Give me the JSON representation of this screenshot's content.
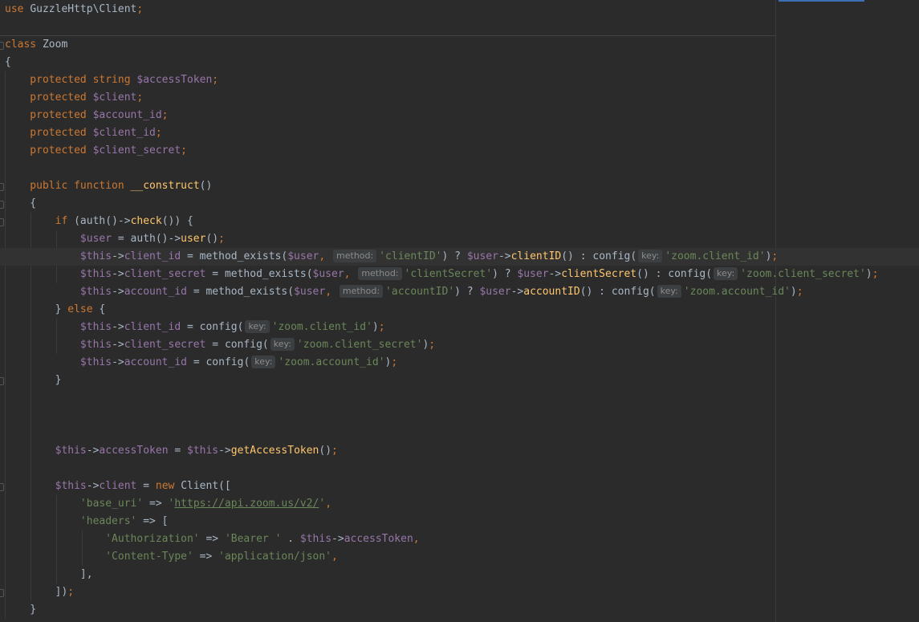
{
  "editor": {
    "lines": [
      {
        "segments": [
          {
            "t": "use ",
            "c": "kw"
          },
          {
            "t": "GuzzleHttp\\Client",
            "c": "cls"
          },
          {
            "t": ";",
            "c": "kw"
          }
        ]
      },
      {
        "segments": []
      },
      {
        "segments": [
          {
            "t": "class ",
            "c": "kw"
          },
          {
            "t": "Zoom",
            "c": "cls"
          }
        ]
      },
      {
        "segments": [
          {
            "t": "{",
            "c": "pl"
          }
        ]
      },
      {
        "segments": [
          {
            "t": "    protected string ",
            "c": "kw"
          },
          {
            "t": "$accessToken",
            "c": "var"
          },
          {
            "t": ";",
            "c": "kw"
          }
        ]
      },
      {
        "segments": [
          {
            "t": "    protected ",
            "c": "kw"
          },
          {
            "t": "$client",
            "c": "var"
          },
          {
            "t": ";",
            "c": "kw"
          }
        ]
      },
      {
        "segments": [
          {
            "t": "    protected ",
            "c": "kw"
          },
          {
            "t": "$account_id",
            "c": "var"
          },
          {
            "t": ";",
            "c": "kw"
          }
        ]
      },
      {
        "segments": [
          {
            "t": "    protected ",
            "c": "kw"
          },
          {
            "t": "$client_id",
            "c": "var"
          },
          {
            "t": ";",
            "c": "kw"
          }
        ]
      },
      {
        "segments": [
          {
            "t": "    protected ",
            "c": "kw"
          },
          {
            "t": "$client_secret",
            "c": "var"
          },
          {
            "t": ";",
            "c": "kw"
          }
        ]
      },
      {
        "segments": []
      },
      {
        "segments": [
          {
            "t": "    public function ",
            "c": "kw"
          },
          {
            "t": "__construct",
            "c": "fn"
          },
          {
            "t": "()",
            "c": "pl"
          }
        ]
      },
      {
        "segments": [
          {
            "t": "    {",
            "c": "pl"
          }
        ]
      },
      {
        "segments": [
          {
            "t": "        ",
            "c": "pl"
          },
          {
            "t": "if ",
            "c": "kw"
          },
          {
            "t": "(auth()->",
            "c": "pl"
          },
          {
            "t": "check",
            "c": "fn"
          },
          {
            "t": "()) {",
            "c": "pl"
          }
        ]
      },
      {
        "segments": [
          {
            "t": "            ",
            "c": "pl"
          },
          {
            "t": "$user",
            "c": "var"
          },
          {
            "t": " = auth()->",
            "c": "pl"
          },
          {
            "t": "user",
            "c": "fn"
          },
          {
            "t": "()",
            "c": "pl"
          },
          {
            "t": ";",
            "c": "kw"
          }
        ]
      },
      {
        "current": true,
        "segments": [
          {
            "t": "            ",
            "c": "pl"
          },
          {
            "t": "$this",
            "c": "var"
          },
          {
            "t": "->",
            "c": "pl"
          },
          {
            "t": "client_id",
            "c": "var"
          },
          {
            "t": " = method_exists(",
            "c": "pl"
          },
          {
            "t": "$user",
            "c": "var"
          },
          {
            "t": ", ",
            "c": "kw"
          },
          {
            "t": "method:",
            "c": "hint"
          },
          {
            "t": "'clientID'",
            "c": "str"
          },
          {
            "t": ") ? ",
            "c": "pl"
          },
          {
            "t": "$user",
            "c": "var"
          },
          {
            "t": "->",
            "c": "pl"
          },
          {
            "t": "clientID",
            "c": "fn"
          },
          {
            "t": "() : config(",
            "c": "pl"
          },
          {
            "t": "key:",
            "c": "hint"
          },
          {
            "t": "'zoom.client_id'",
            "c": "str"
          },
          {
            "t": ")",
            "c": "pl"
          },
          {
            "t": ";",
            "c": "kw"
          }
        ]
      },
      {
        "segments": [
          {
            "t": "            ",
            "c": "pl"
          },
          {
            "t": "$this",
            "c": "var"
          },
          {
            "t": "->",
            "c": "pl"
          },
          {
            "t": "client_secret",
            "c": "var"
          },
          {
            "t": " = method_exists(",
            "c": "pl"
          },
          {
            "t": "$user",
            "c": "var"
          },
          {
            "t": ", ",
            "c": "kw"
          },
          {
            "t": "method:",
            "c": "hint"
          },
          {
            "t": "'clientSecret'",
            "c": "str"
          },
          {
            "t": ") ? ",
            "c": "pl"
          },
          {
            "t": "$user",
            "c": "var"
          },
          {
            "t": "->",
            "c": "pl"
          },
          {
            "t": "clientSecret",
            "c": "fn"
          },
          {
            "t": "() : config(",
            "c": "pl"
          },
          {
            "t": "key:",
            "c": "hint"
          },
          {
            "t": "'zoom.client_secret'",
            "c": "str"
          },
          {
            "t": ")",
            "c": "pl"
          },
          {
            "t": ";",
            "c": "kw"
          }
        ]
      },
      {
        "segments": [
          {
            "t": "            ",
            "c": "pl"
          },
          {
            "t": "$this",
            "c": "var"
          },
          {
            "t": "->",
            "c": "pl"
          },
          {
            "t": "account_id",
            "c": "var"
          },
          {
            "t": " = method_exists(",
            "c": "pl"
          },
          {
            "t": "$user",
            "c": "var"
          },
          {
            "t": ", ",
            "c": "kw"
          },
          {
            "t": "method:",
            "c": "hint"
          },
          {
            "t": "'accountID'",
            "c": "str"
          },
          {
            "t": ") ? ",
            "c": "pl"
          },
          {
            "t": "$user",
            "c": "var"
          },
          {
            "t": "->",
            "c": "pl"
          },
          {
            "t": "accountID",
            "c": "fn"
          },
          {
            "t": "() : config(",
            "c": "pl"
          },
          {
            "t": "key:",
            "c": "hint"
          },
          {
            "t": "'zoom.account_id'",
            "c": "str"
          },
          {
            "t": ")",
            "c": "pl"
          },
          {
            "t": ";",
            "c": "kw"
          }
        ]
      },
      {
        "segments": [
          {
            "t": "        } ",
            "c": "pl"
          },
          {
            "t": "else ",
            "c": "kw"
          },
          {
            "t": "{",
            "c": "pl"
          }
        ]
      },
      {
        "segments": [
          {
            "t": "            ",
            "c": "pl"
          },
          {
            "t": "$this",
            "c": "var"
          },
          {
            "t": "->",
            "c": "pl"
          },
          {
            "t": "client_id",
            "c": "var"
          },
          {
            "t": " = config(",
            "c": "pl"
          },
          {
            "t": "key:",
            "c": "hint"
          },
          {
            "t": "'zoom.client_id'",
            "c": "str"
          },
          {
            "t": ")",
            "c": "pl"
          },
          {
            "t": ";",
            "c": "kw"
          }
        ]
      },
      {
        "segments": [
          {
            "t": "            ",
            "c": "pl"
          },
          {
            "t": "$this",
            "c": "var"
          },
          {
            "t": "->",
            "c": "pl"
          },
          {
            "t": "client_secret",
            "c": "var"
          },
          {
            "t": " = config(",
            "c": "pl"
          },
          {
            "t": "key:",
            "c": "hint"
          },
          {
            "t": "'zoom.client_secret'",
            "c": "str"
          },
          {
            "t": ")",
            "c": "pl"
          },
          {
            "t": ";",
            "c": "kw"
          }
        ]
      },
      {
        "segments": [
          {
            "t": "            ",
            "c": "pl"
          },
          {
            "t": "$this",
            "c": "var"
          },
          {
            "t": "->",
            "c": "pl"
          },
          {
            "t": "account_id",
            "c": "var"
          },
          {
            "t": " = config(",
            "c": "pl"
          },
          {
            "t": "key:",
            "c": "hint"
          },
          {
            "t": "'zoom.account_id'",
            "c": "str"
          },
          {
            "t": ")",
            "c": "pl"
          },
          {
            "t": ";",
            "c": "kw"
          }
        ]
      },
      {
        "segments": [
          {
            "t": "        }",
            "c": "pl"
          }
        ]
      },
      {
        "segments": []
      },
      {
        "segments": []
      },
      {
        "segments": []
      },
      {
        "segments": [
          {
            "t": "        ",
            "c": "pl"
          },
          {
            "t": "$this",
            "c": "var"
          },
          {
            "t": "->",
            "c": "pl"
          },
          {
            "t": "accessToken",
            "c": "var"
          },
          {
            "t": " = ",
            "c": "pl"
          },
          {
            "t": "$this",
            "c": "var"
          },
          {
            "t": "->",
            "c": "pl"
          },
          {
            "t": "getAccessToken",
            "c": "fn"
          },
          {
            "t": "()",
            "c": "pl"
          },
          {
            "t": ";",
            "c": "kw"
          }
        ]
      },
      {
        "segments": []
      },
      {
        "segments": [
          {
            "t": "        ",
            "c": "pl"
          },
          {
            "t": "$this",
            "c": "var"
          },
          {
            "t": "->",
            "c": "pl"
          },
          {
            "t": "client",
            "c": "var"
          },
          {
            "t": " = ",
            "c": "pl"
          },
          {
            "t": "new ",
            "c": "kw"
          },
          {
            "t": "Client([",
            "c": "pl"
          }
        ]
      },
      {
        "segments": [
          {
            "t": "            ",
            "c": "pl"
          },
          {
            "t": "'base_uri'",
            "c": "str"
          },
          {
            "t": " => ",
            "c": "pl"
          },
          {
            "t": "'",
            "c": "str"
          },
          {
            "t": "https://api.zoom.us/v2/",
            "c": "link"
          },
          {
            "t": "'",
            "c": "str"
          },
          {
            "t": ",",
            "c": "kw"
          }
        ]
      },
      {
        "segments": [
          {
            "t": "            ",
            "c": "pl"
          },
          {
            "t": "'headers'",
            "c": "str"
          },
          {
            "t": " => [",
            "c": "pl"
          }
        ]
      },
      {
        "segments": [
          {
            "t": "                ",
            "c": "pl"
          },
          {
            "t": "'Authorization'",
            "c": "str"
          },
          {
            "t": " => ",
            "c": "pl"
          },
          {
            "t": "'Bearer '",
            "c": "str"
          },
          {
            "t": " . ",
            "c": "pl"
          },
          {
            "t": "$this",
            "c": "var"
          },
          {
            "t": "->",
            "c": "pl"
          },
          {
            "t": "accessToken",
            "c": "var"
          },
          {
            "t": ",",
            "c": "kw"
          }
        ]
      },
      {
        "segments": [
          {
            "t": "                ",
            "c": "pl"
          },
          {
            "t": "'Content-Type'",
            "c": "str"
          },
          {
            "t": " => ",
            "c": "pl"
          },
          {
            "t": "'application/json'",
            "c": "str"
          },
          {
            "t": ",",
            "c": "kw"
          }
        ]
      },
      {
        "segments": [
          {
            "t": "            ],",
            "c": "pl"
          }
        ]
      },
      {
        "segments": [
          {
            "t": "        ])",
            "c": "pl"
          },
          {
            "t": ";",
            "c": "kw"
          }
        ]
      },
      {
        "segments": [
          {
            "t": "    }",
            "c": "pl"
          }
        ]
      }
    ]
  }
}
